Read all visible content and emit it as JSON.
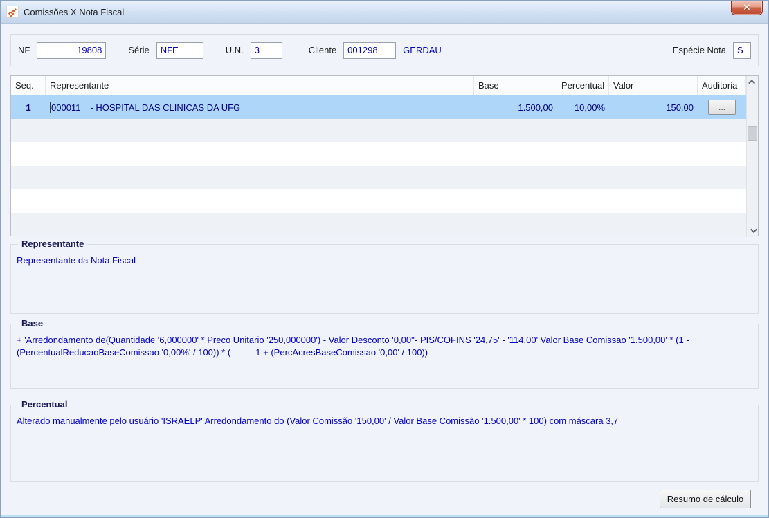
{
  "window": {
    "title": "Comissões X Nota Fiscal",
    "close_glyph": "✕"
  },
  "form": {
    "nf": {
      "label": "NF",
      "value": "19808"
    },
    "serie": {
      "label": "Série",
      "value": "NFE"
    },
    "un": {
      "label": "U.N.",
      "value": "3"
    },
    "cliente": {
      "label": "Cliente",
      "value": "001298",
      "display_name": "GERDAU"
    },
    "especie": {
      "label": "Espécie Nota",
      "value": "S"
    }
  },
  "grid": {
    "columns": [
      "Seq.",
      "Representante",
      "Base",
      "Percentual",
      "Valor",
      "Auditoria"
    ],
    "rows": [
      {
        "seq": "1",
        "rep_code": "000011",
        "rep_name": "- HOSPITAL DAS CLINICAS DA UFG",
        "base": "1.500,00",
        "percentual": "10,00%",
        "valor": "150,00",
        "auditoria_button": "..."
      }
    ]
  },
  "groups": {
    "representante": {
      "title": "Representante",
      "text": "Representante da Nota Fiscal"
    },
    "base": {
      "title": "Base",
      "text": "+ 'Arredondamento de(Quantidade '6,000000' * Preco Unitario '250,000000') - Valor Desconto '0,00''- PIS/COFINS '24,75' - '114,00' Valor Base Comissao '1.500,00' * (1 - (PercentualReducaoBaseComissao '0,00%' / 100)) * (          1 + (PercAcresBaseComissao '0,00' / 100))"
    },
    "percentual": {
      "title": "Percentual",
      "text": "Alterado manualmente pelo usuário 'ISRAELP' Arredondamento do (Valor Comissão '150,00' / Valor Base Comissão '1.500,00' * 100) com máscara 3,7"
    }
  },
  "footer": {
    "resumo_accel": "R",
    "resumo_rest": "esumo de cálculo"
  }
}
